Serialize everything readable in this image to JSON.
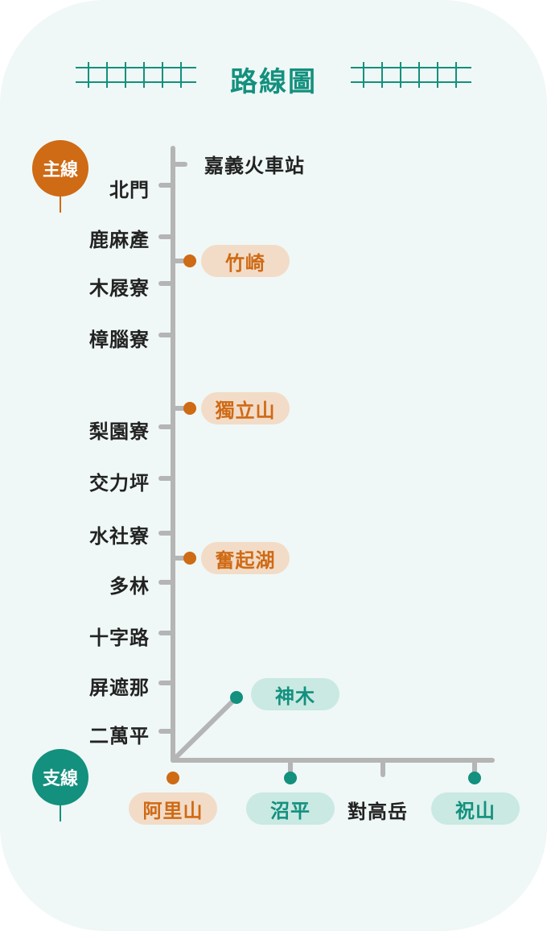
{
  "title": "路線圖",
  "legend": {
    "main_line": "主線",
    "branch_line": "支線"
  },
  "main_stations": [
    "嘉義火車站",
    "北門",
    "鹿麻產",
    "木屐寮",
    "樟腦寮",
    "梨園寮",
    "交力坪",
    "水社寮",
    "多林",
    "十字路",
    "屏遮那",
    "二萬平"
  ],
  "branch_stations_main_side": [
    "竹崎",
    "獨立山",
    "奮起湖"
  ],
  "branch_line_stations": [
    "阿里山",
    "沼平",
    "對高岳",
    "祝山"
  ],
  "diagonal_station": "神木",
  "colors": {
    "background": "#eff8f6",
    "track": "#b5b5b5",
    "teal": "#13907e",
    "orange": "#cf6a15",
    "orange_pill": "#f2dcc8",
    "teal_pill": "#c9e9e2",
    "text": "#222222"
  }
}
